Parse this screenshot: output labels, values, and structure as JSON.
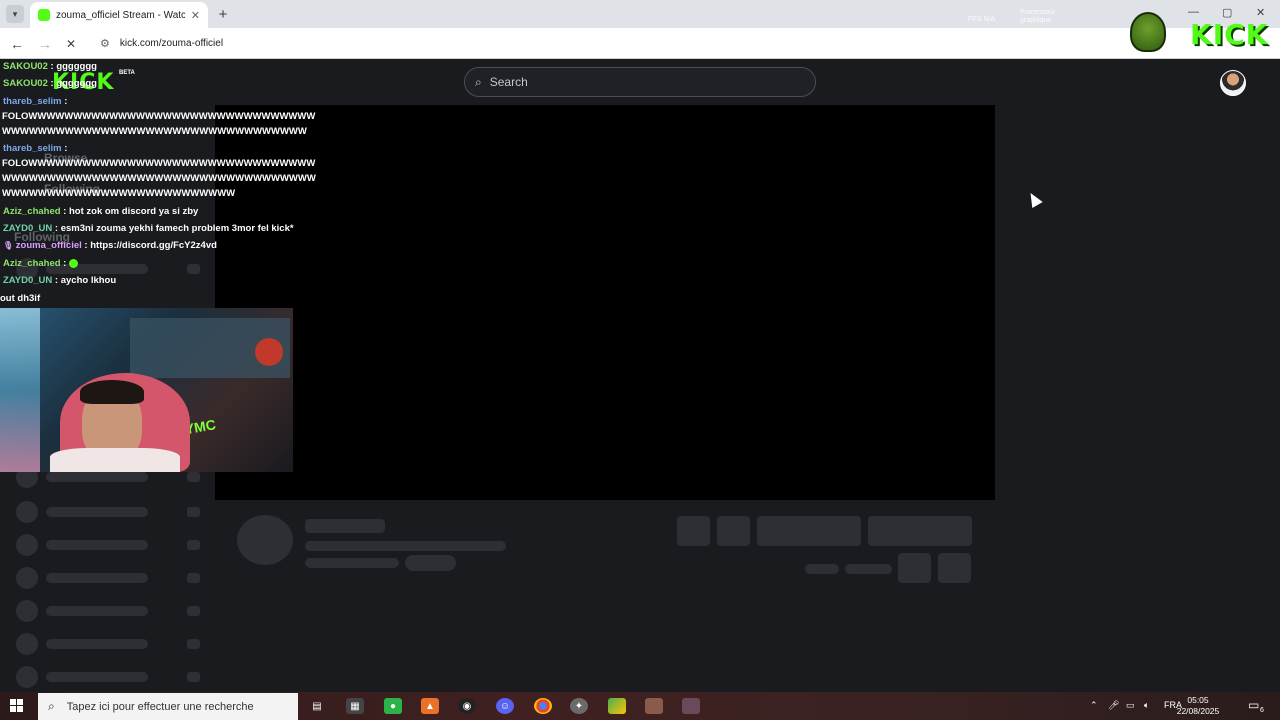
{
  "browser": {
    "tab_title": "zouma_officiel Stream - Watch",
    "tab_close": "✕",
    "new_tab": "+",
    "back": "←",
    "forward": "→",
    "reload": "✕",
    "url": "kick.com/zouma-officiel",
    "window_controls": [
      "—",
      "▢",
      "✕"
    ]
  },
  "site": {
    "logo": "KICK",
    "beta": "BETA",
    "search_placeholder": "Search",
    "nav_ghost": [
      "Browse",
      "Following",
      "Following"
    ]
  },
  "overlay": {
    "logo": "KICK",
    "labels": [
      "FPS N/A",
      "Processeur graphique"
    ]
  },
  "chat": [
    {
      "user": "SAKOU02",
      "text": " : ggggggg",
      "color": "#8ee36b"
    },
    {
      "user": "SAKOU02",
      "text": " : ggggggg",
      "color": "#8ee36b"
    },
    {
      "user": "thareb_selim",
      "text": " :",
      "color": "#7ea7e8"
    },
    {
      "user": "",
      "text": "FOLOWWWWWWWWWWWWWWWWWWWWWWWWWWWWWWWWWWWWWWWWWWWWWWWWWWWWWWWWWWWWWWWWWW",
      "color": "#fff"
    },
    {
      "user": "thareb_selim",
      "text": " :",
      "color": "#7ea7e8"
    },
    {
      "user": "",
      "text": "FOLOWWWWWWWWWWWWWWWWWWWWWWWWWWWWWWWWWWWWWWWWWWWWWWWWWWWWWWWWWWWWWWWWWWWWWWWWWWWWWWWWWWWWWWWWWWWWW",
      "color": "#fff"
    },
    {
      "user": "Aziz_chahed",
      "text": " : hot zok om discord ya si zby",
      "color": "#8ee36b"
    },
    {
      "user": "ZAYD0_UN",
      "text": " : esm3ni zouma yekhi famech problem 3mor fel kick*",
      "color": "#6fd3a7"
    },
    {
      "user": "zouma_officiel",
      "text": " : https://discord.gg/FcY2z4vd",
      "color": "#d9a0ff"
    },
    {
      "user": "Aziz_chahed",
      "text": " : ",
      "color": "#8ee36b"
    },
    {
      "user": "ZAYD0_UN",
      "text": " : aycho lkhou",
      "color": "#6fd3a7"
    },
    {
      "user": "",
      "text": "out dh3if",
      "color": "#fff"
    }
  ],
  "webcam": {
    "sign": "YMC"
  },
  "taskbar": {
    "search_placeholder": "Tapez ici pour effectuer une recherche",
    "lang": "FRA",
    "time": "05:05",
    "date": "22/08/2025",
    "notif_count": "6"
  },
  "colors": {
    "kick_green": "#53fc18",
    "page_bg": "#191b1f",
    "skeleton": "#2d2f35"
  }
}
